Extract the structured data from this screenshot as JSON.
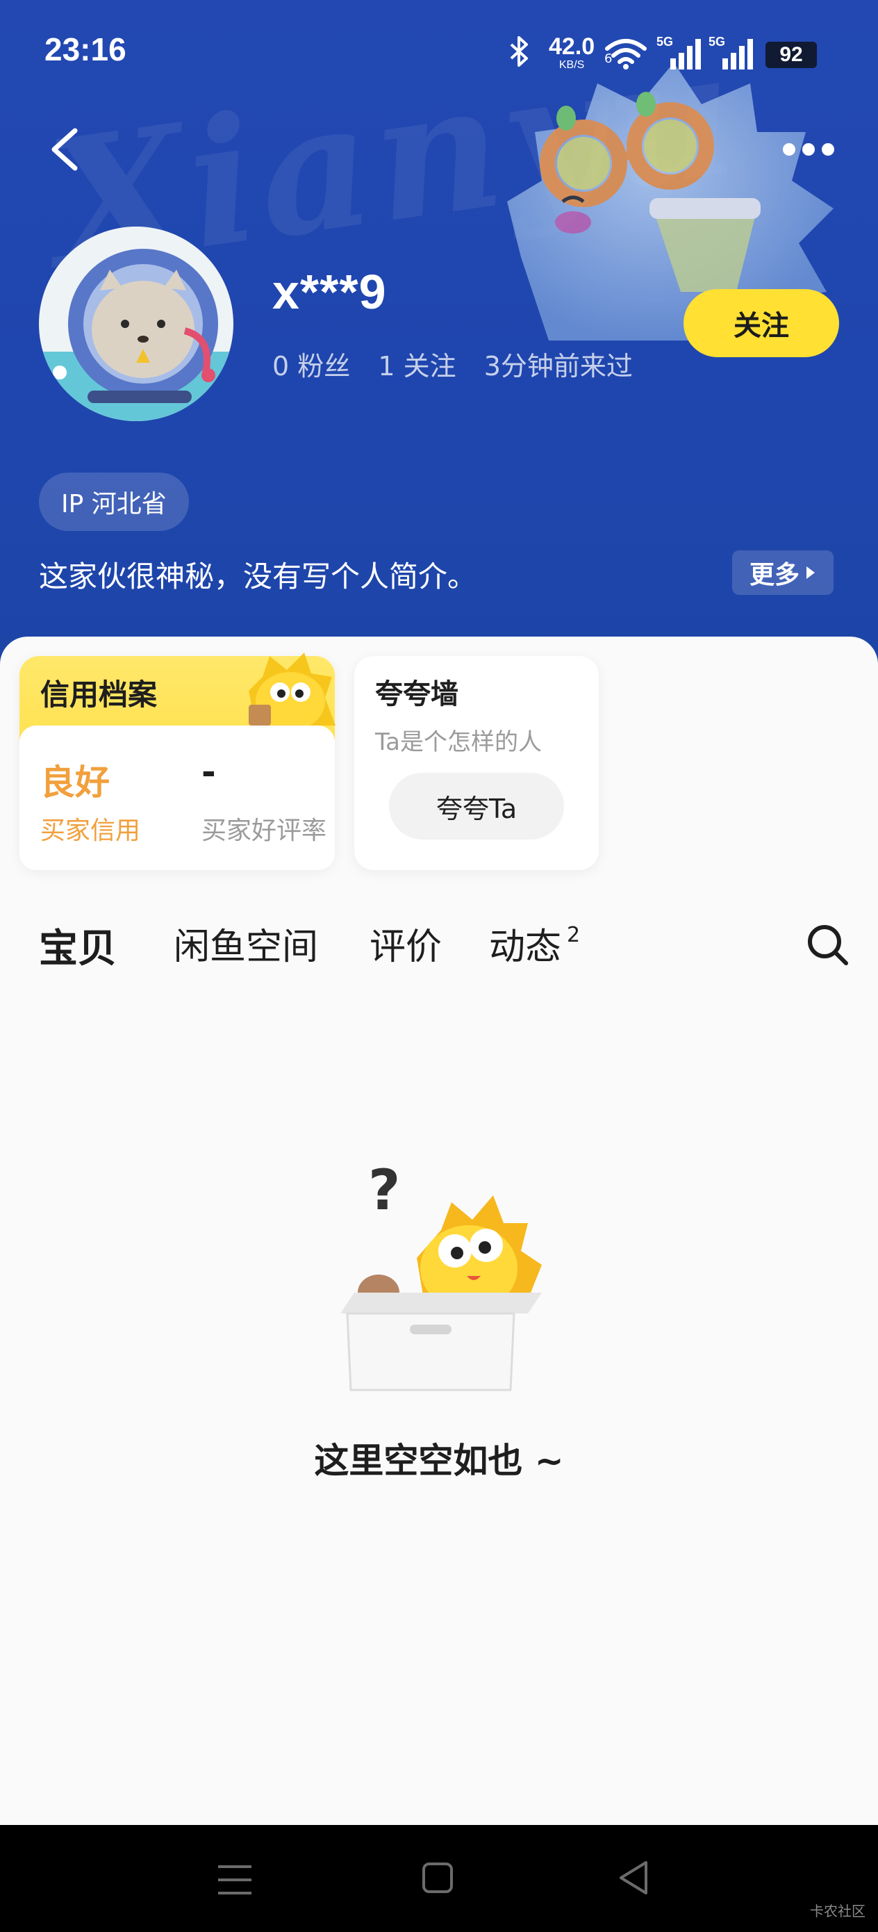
{
  "status_bar": {
    "time": "23:16",
    "net_speed": "42.0",
    "net_speed_unit": "KB/S",
    "wifi_badge": "6",
    "signal1_label": "5G",
    "signal2_label": "5G",
    "battery": "92"
  },
  "header": {
    "watermark": "Xianyu"
  },
  "profile": {
    "username": "x***9",
    "fans": "0 粉丝",
    "following": "1 关注",
    "last_seen": "3分钟前来过",
    "follow_label": "关注",
    "ip": "IP 河北省",
    "bio": "这家伙很神秘，没有写个人简介。",
    "more_label": "更多"
  },
  "credit": {
    "title": "信用档案",
    "rating": "良好",
    "rating_label": "买家信用",
    "rate_value": "-",
    "rate_label": "买家好评率"
  },
  "praise": {
    "title": "夸夸墙",
    "subtitle": "Ta是个怎样的人",
    "button": "夸夸Ta"
  },
  "tabs": [
    {
      "label": "宝贝",
      "active": true
    },
    {
      "label": "闲鱼空间",
      "active": false
    },
    {
      "label": "评价",
      "active": false
    },
    {
      "label": "动态",
      "active": false,
      "badge": "2"
    }
  ],
  "empty": {
    "text": "这里空空如也 ~"
  },
  "footer": {
    "watermark": "卡农社区"
  },
  "colors": {
    "header_blue": "#2348b2",
    "accent_yellow": "#ffe033",
    "credit_orange": "#f1a03d"
  }
}
